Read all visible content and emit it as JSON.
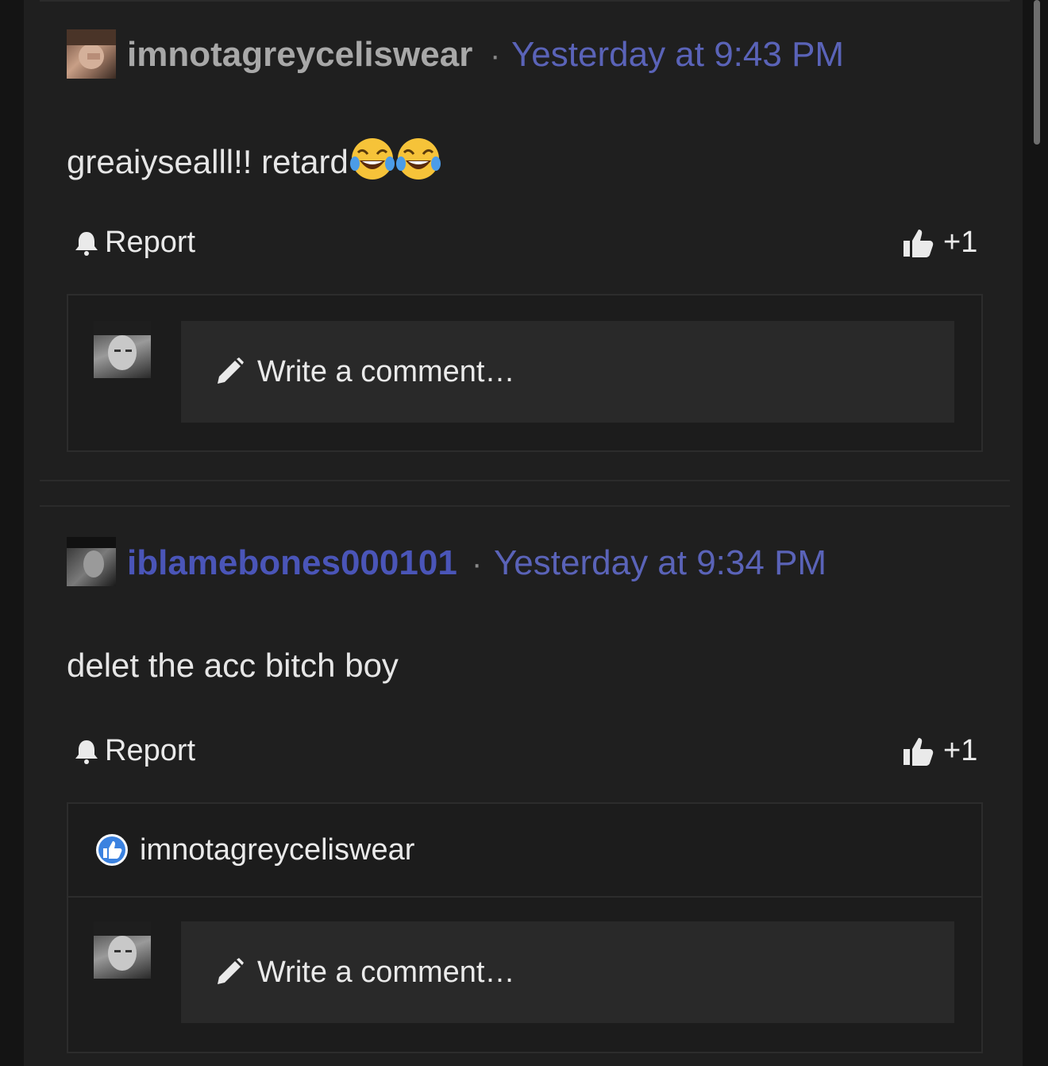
{
  "colors": {
    "page_bg": "#141414",
    "panel_bg": "#1f1f1f",
    "timestamp": "#5a63b8",
    "username_default": "#a8a8a8",
    "username_link": "#4a55b8",
    "like_badge": "#3b82e0"
  },
  "posts": [
    {
      "username": "imnotagreyceliswear",
      "username_color": "#a8a8a8",
      "separator": "·",
      "timestamp": "Yesterday at 9:43 PM",
      "body": "greaiysealll!! retard",
      "body_emojis": [
        "face-with-tears-of-joy",
        "face-with-tears-of-joy"
      ],
      "report_label": "Report",
      "report_icon": "bell-icon",
      "like_icon": "thumbs-up-icon",
      "like_count": "+1",
      "comment_placeholder": "Write a comment…",
      "likers": []
    },
    {
      "username": "iblamebones000101",
      "username_color": "#4a55b8",
      "separator": "·",
      "timestamp": "Yesterday at 9:34 PM",
      "body": "delet the acc bitch boy",
      "body_emojis": [],
      "report_label": "Report",
      "report_icon": "bell-icon",
      "like_icon": "thumbs-up-icon",
      "like_count": "+1",
      "comment_placeholder": "Write a comment…",
      "likers": [
        "imnotagreyceliswear"
      ]
    }
  ]
}
